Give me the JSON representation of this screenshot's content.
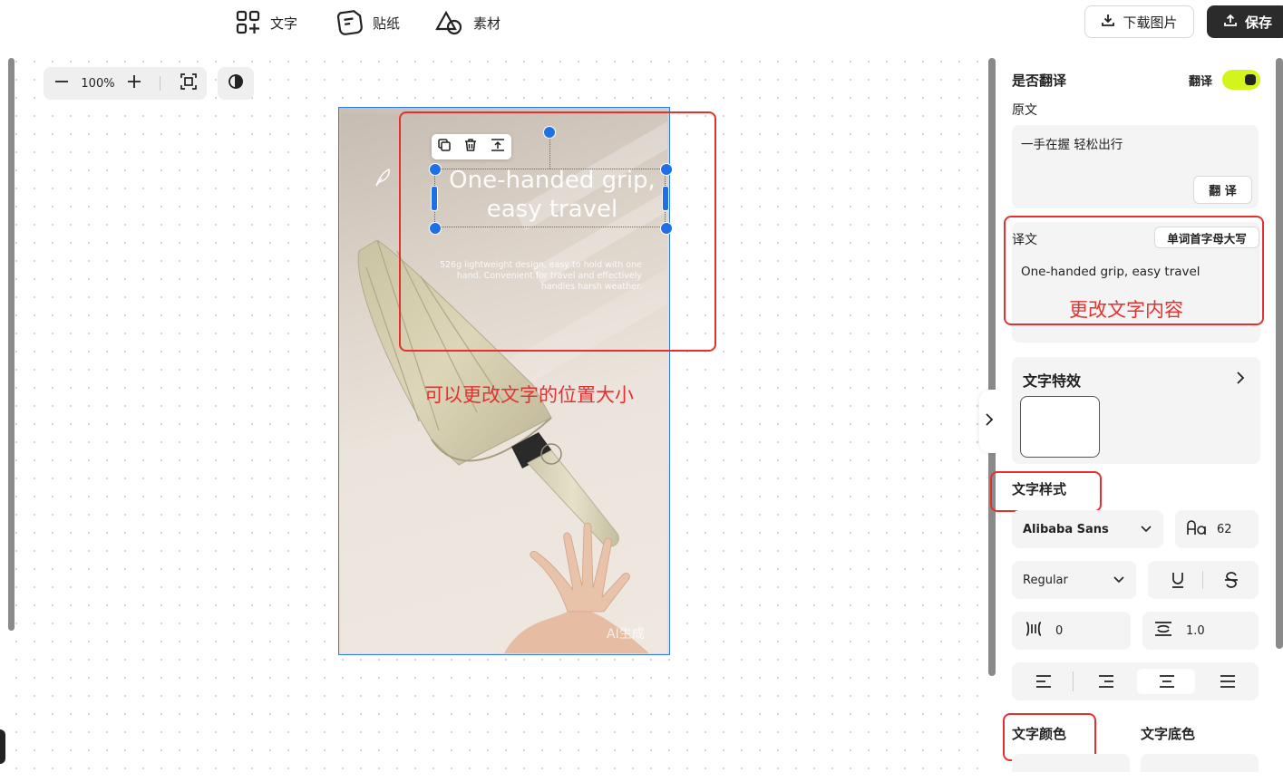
{
  "toolbar": {
    "text_tool": "文字",
    "sticker_tool": "贴纸",
    "material_tool": "素材",
    "download_label": "下载图片",
    "save_label": "保存"
  },
  "canvas": {
    "zoom_level": "100%",
    "poster_title": "One-handed grip, easy travel",
    "poster_subtitle": "526g lightweight design, easy to hold with one hand. Convenient for travel and effectively handles harsh weather.",
    "ai_tag": "AI生成",
    "annotation_position": "可以更改文字的位置大小"
  },
  "panel": {
    "translate_question": "是否翻译",
    "translate_toggle_label": "翻译",
    "translate_enabled": true,
    "original_label": "原文",
    "original_text": "一手在握 轻松出行",
    "translate_button": "翻 译",
    "translated_label": "译文",
    "capitalize_button": "单词首字母大写",
    "translated_text": "One-handed grip, easy travel",
    "annotation_change_text": "更改文字内容",
    "effects_label": "文字特效",
    "style_label": "文字样式",
    "font_family": "Alibaba Sans",
    "font_size": "62",
    "font_weight": "Regular",
    "letter_spacing": "0",
    "line_height": "1.0",
    "color_label": "文字颜色",
    "bg_color_label": "文字底色"
  },
  "colors": {
    "accent_blue": "#1f6fe5",
    "annotation_red": "#e63030",
    "toggle_green": "#d4f51c",
    "save_button_dark": "#2b2b2b"
  },
  "icons": [
    "grid-plus-icon",
    "sticker-icon",
    "shapes-icon",
    "download-icon",
    "upload-icon",
    "minus-icon",
    "plus-icon",
    "fit-screen-icon",
    "contrast-icon",
    "feather-icon",
    "copy-icon",
    "trash-icon",
    "layer-up-icon",
    "chevron-right-icon",
    "chevron-down-icon",
    "font-size-icon",
    "underline-icon",
    "strikethrough-icon",
    "letter-spacing-icon",
    "line-height-icon",
    "align-left-icon",
    "align-right-icon",
    "align-center-icon",
    "align-justify-icon"
  ]
}
